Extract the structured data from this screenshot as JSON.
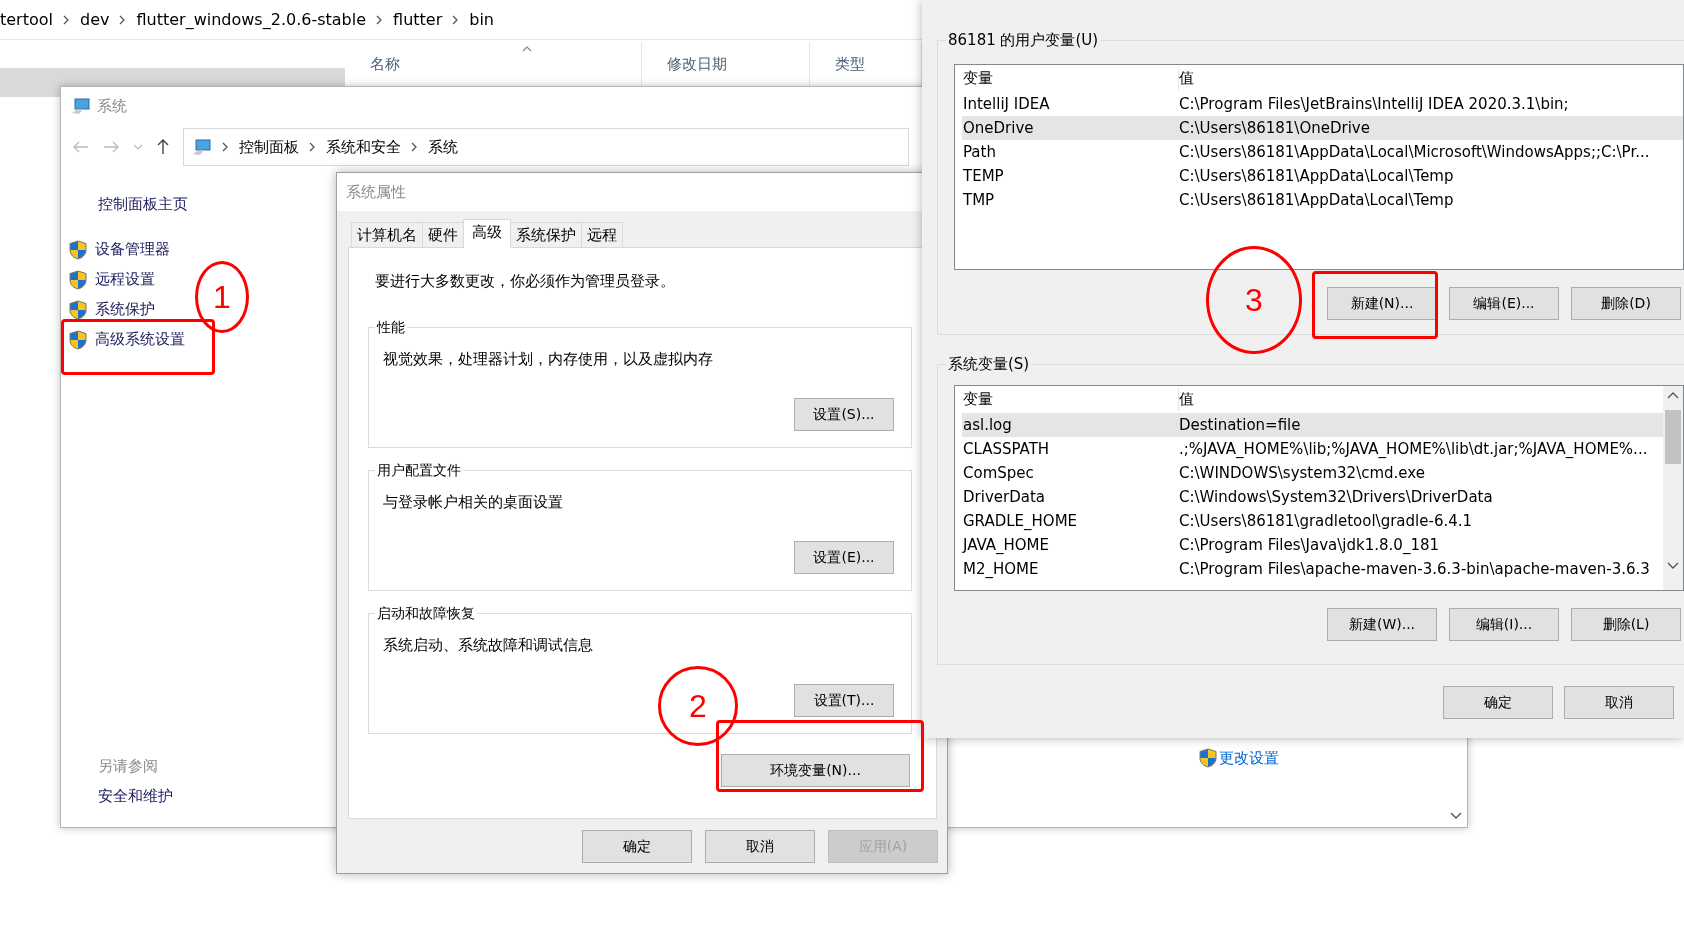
{
  "explorer": {
    "breadcrumb": [
      "tertool",
      "dev",
      "flutter_windows_2.0.6-stable",
      "flutter",
      "bin"
    ],
    "columns": [
      "名称",
      "修改日期",
      "类型"
    ]
  },
  "system_window": {
    "title": "系统",
    "address": [
      "控制面板",
      "系统和安全",
      "系统"
    ],
    "home_link": "控制面板主页",
    "links": [
      {
        "label": "设备管理器"
      },
      {
        "label": "远程设置"
      },
      {
        "label": "系统保护"
      },
      {
        "label": "高级系统设置"
      }
    ],
    "see_also": "另请参阅",
    "see_also_links": [
      "安全和维护"
    ],
    "change_settings": "更改设置"
  },
  "properties_dialog": {
    "title": "系统属性",
    "tabs": [
      {
        "label": "计算机名",
        "selected": false
      },
      {
        "label": "硬件",
        "selected": false
      },
      {
        "label": "高级",
        "selected": true
      },
      {
        "label": "系统保护",
        "selected": false
      },
      {
        "label": "远程",
        "selected": false
      }
    ],
    "notice": "要进行大多数更改，你必须作为管理员登录。",
    "groups": [
      {
        "title": "性能",
        "description": "视觉效果，处理器计划，内存使用，以及虚拟内存",
        "button": "设置(S)..."
      },
      {
        "title": "用户配置文件",
        "description": "与登录帐户相关的桌面设置",
        "button": "设置(E)..."
      },
      {
        "title": "启动和故障恢复",
        "description": "系统启动、系统故障和调试信息",
        "button": "设置(T)..."
      }
    ],
    "env_button": "环境变量(N)...",
    "buttons": [
      {
        "label": "确定",
        "disabled": false
      },
      {
        "label": "取消",
        "disabled": false
      },
      {
        "label": "应用(A)",
        "disabled": true
      }
    ]
  },
  "env_dialog": {
    "user_vars": {
      "title": "86181 的用户变量(U)",
      "columns": [
        "变量",
        "值"
      ],
      "rows": [
        {
          "name": "IntelliJ IDEA",
          "value": "C:\\Program Files\\JetBrains\\IntelliJ IDEA 2020.3.1\\bin;",
          "selected": false
        },
        {
          "name": "OneDrive",
          "value": "C:\\Users\\86181\\OneDrive",
          "selected": true
        },
        {
          "name": "Path",
          "value": "C:\\Users\\86181\\AppData\\Local\\Microsoft\\WindowsApps;;C:\\Pr...",
          "selected": false
        },
        {
          "name": "TEMP",
          "value": "C:\\Users\\86181\\AppData\\Local\\Temp",
          "selected": false
        },
        {
          "name": "TMP",
          "value": "C:\\Users\\86181\\AppData\\Local\\Temp",
          "selected": false
        }
      ],
      "buttons": [
        "新建(N)...",
        "编辑(E)...",
        "删除(D)"
      ]
    },
    "system_vars": {
      "title": "系统变量(S)",
      "columns": [
        "变量",
        "值"
      ],
      "rows": [
        {
          "name": "asl.log",
          "value": "Destination=file",
          "selected": true
        },
        {
          "name": "CLASSPATH",
          "value": ".;%JAVA_HOME%\\lib;%JAVA_HOME%\\lib\\dt.jar;%JAVA_HOME%...",
          "selected": false
        },
        {
          "name": "ComSpec",
          "value": "C:\\WINDOWS\\system32\\cmd.exe",
          "selected": false
        },
        {
          "name": "DriverData",
          "value": "C:\\Windows\\System32\\Drivers\\DriverData",
          "selected": false
        },
        {
          "name": "GRADLE_HOME",
          "value": "C:\\Users\\86181\\gradletool\\gradle-6.4.1",
          "selected": false
        },
        {
          "name": "JAVA_HOME",
          "value": "C:\\Program Files\\Java\\jdk1.8.0_181",
          "selected": false
        },
        {
          "name": "M2_HOME",
          "value": "C:\\Program Files\\apache-maven-3.6.3-bin\\apache-maven-3.6.3",
          "selected": false
        }
      ],
      "buttons": [
        "新建(W)...",
        "编辑(I)...",
        "删除(L)"
      ]
    },
    "buttons": [
      "确定",
      "取消"
    ]
  },
  "annotations": [
    {
      "label": "1"
    },
    {
      "label": "2"
    },
    {
      "label": "3"
    }
  ]
}
